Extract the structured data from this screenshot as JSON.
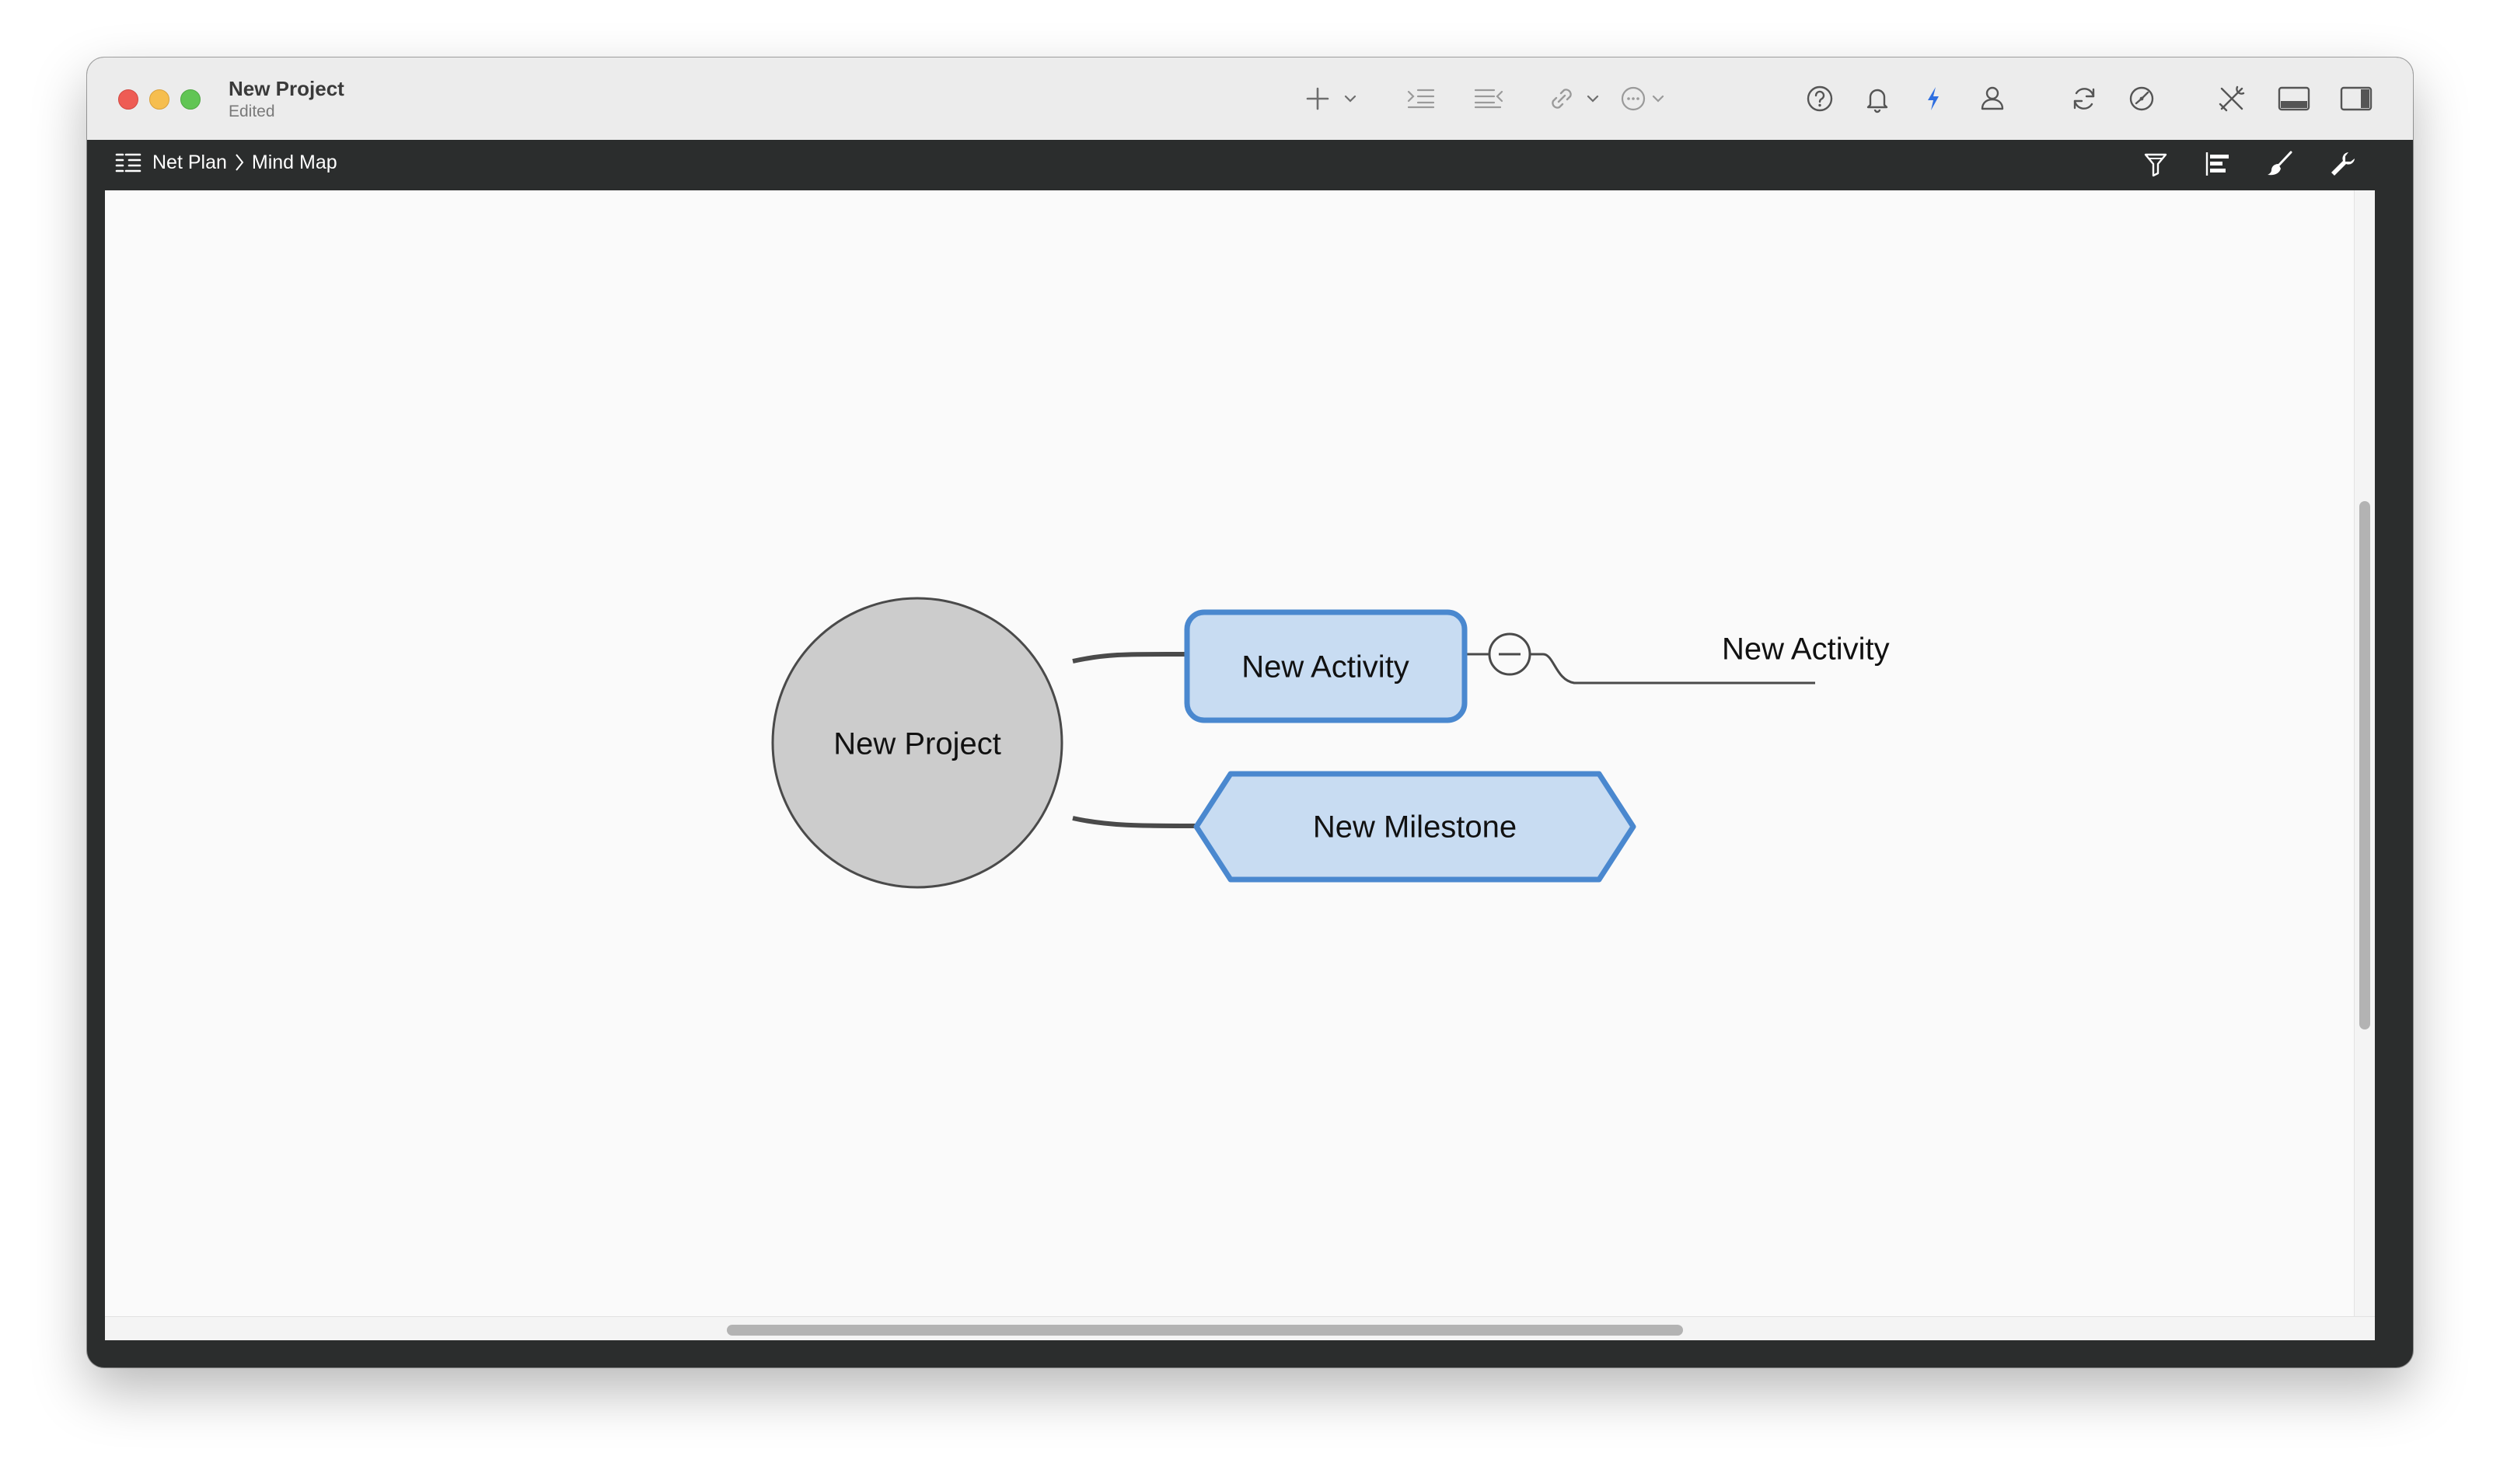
{
  "window": {
    "title": "New Project",
    "subtitle": "Edited"
  },
  "toolbar": {
    "icons": [
      "plus-icon",
      "chevron-down-icon",
      "indent-icon",
      "outdent-icon",
      "link-icon",
      "chevron-down-icon",
      "more-icon",
      "chevron-down-icon",
      "help-icon",
      "bell-icon",
      "bolt-icon",
      "person-icon",
      "sync-icon",
      "gauge-icon",
      "tools-icon",
      "bottom-panel-icon",
      "sidebar-icon"
    ],
    "accent_color": "#2f6fe0"
  },
  "pathbar": {
    "breadcrumb": [
      "Net Plan",
      "Mind Map"
    ],
    "right_icons": [
      "filter-icon",
      "gantt-icon",
      "brush-icon",
      "wrench-icon"
    ]
  },
  "mindmap": {
    "root": {
      "label": "New Project",
      "shape": "circle",
      "fill": "#cccccc"
    },
    "children": [
      {
        "label": "New Activity",
        "shape": "rounded-rect",
        "fill": "#c8dcf2",
        "border": "#4a88cf"
      },
      {
        "label": "New Milestone",
        "shape": "hexagon",
        "fill": "#c8dcf2",
        "border": "#4a88cf"
      }
    ],
    "grandchild": {
      "label": "New Activity",
      "shape": "underline"
    },
    "collapse_toggle": "minus-circle-icon"
  }
}
